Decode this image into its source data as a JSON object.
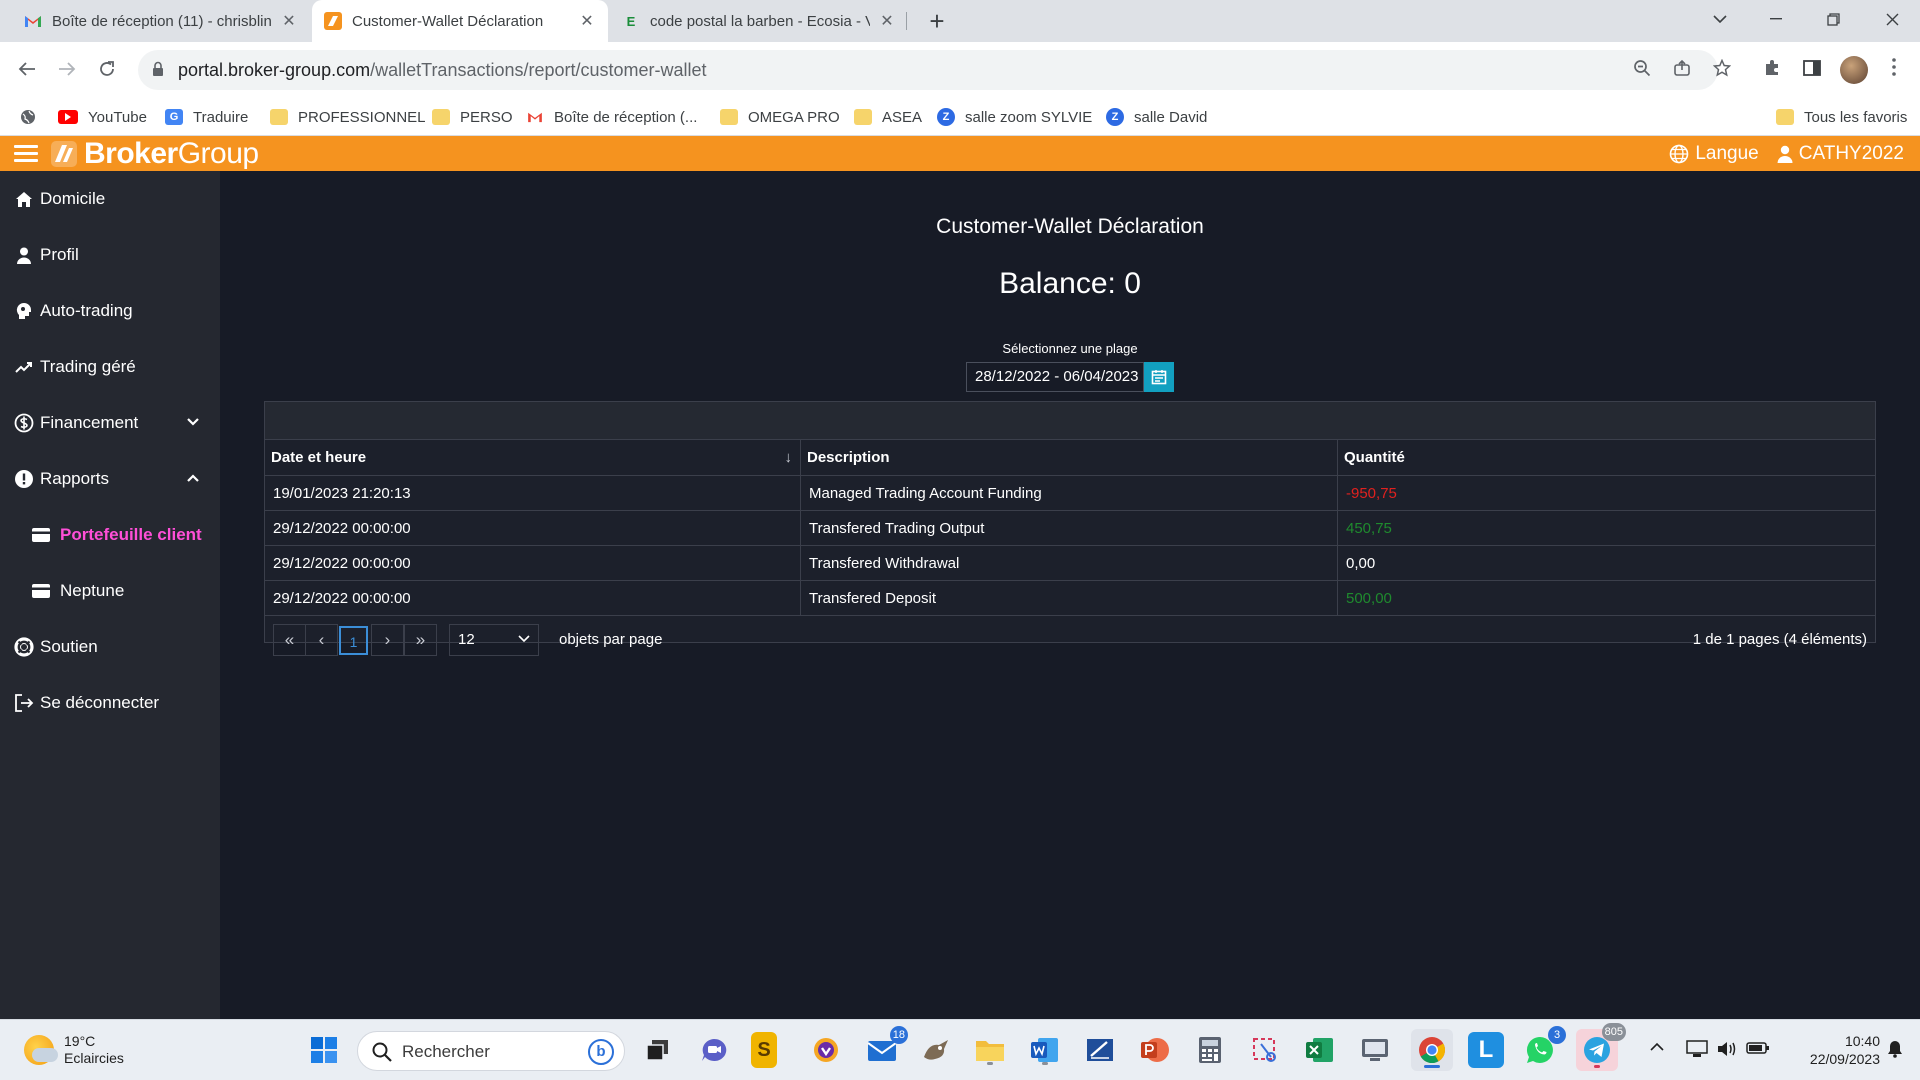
{
  "browser": {
    "tabs": [
      {
        "title": "Boîte de réception (11) - chrisblin",
        "icon": "gmail-icon"
      },
      {
        "title": "Customer-Wallet Déclaration",
        "icon": "brokergroup-icon"
      },
      {
        "title": "code postal la barben - Ecosia - V",
        "icon": "ecosia-icon"
      }
    ],
    "url_host": "portal.broker-group.com",
    "url_path": "/walletTransactions/report/customer-wallet",
    "bookmarks": [
      {
        "label": "YouTube"
      },
      {
        "label": "Traduire"
      },
      {
        "label": "PROFESSIONNEL"
      },
      {
        "label": "PERSO"
      },
      {
        "label": "Boîte de réception (..."
      },
      {
        "label": "OMEGA PRO"
      },
      {
        "label": "ASEA"
      },
      {
        "label": "salle zoom SYLVIE"
      },
      {
        "label": "salle David"
      },
      {
        "label": "Tous les favoris"
      }
    ]
  },
  "app": {
    "logo_bold": "Broker",
    "logo_light": "Group",
    "language_label": "Langue",
    "user_label": "CATHY2022",
    "brand_color": "#f5931f"
  },
  "sidebar": {
    "items": [
      {
        "label": "Domicile",
        "icon": "home-icon"
      },
      {
        "label": "Profil",
        "icon": "user-icon"
      },
      {
        "label": "Auto-trading",
        "icon": "robot-icon"
      },
      {
        "label": "Trading géré",
        "icon": "trend-icon"
      },
      {
        "label": "Financement",
        "icon": "dollar-icon",
        "expanded": false
      },
      {
        "label": "Rapports",
        "icon": "alert-icon",
        "expanded": true
      },
      {
        "label": "Portefeuille client",
        "icon": "wallet-icon",
        "active": true
      },
      {
        "label": "Neptune",
        "icon": "wallet-icon"
      },
      {
        "label": "Soutien",
        "icon": "lifebuoy-icon"
      },
      {
        "label": "Se déconnecter",
        "icon": "logout-icon"
      }
    ]
  },
  "report": {
    "title": "Customer-Wallet Déclaration",
    "balance": "Balance: 0",
    "range_label": "Sélectionnez une plage",
    "range_value": "28/12/2022 - 06/04/2023",
    "columns": [
      "Date et heure",
      "Description",
      "Quantité"
    ],
    "rows": [
      {
        "date": "19/01/2023 21:20:13",
        "description": "Managed Trading Account Funding",
        "amount": "-950,75",
        "tone": "negative"
      },
      {
        "date": "29/12/2022 00:00:00",
        "description": "Transfered Trading Output",
        "amount": "450,75",
        "tone": "positive"
      },
      {
        "date": "29/12/2022 00:00:00",
        "description": "Transfered Withdrawal",
        "amount": "0,00",
        "tone": "neutral"
      },
      {
        "date": "29/12/2022 00:00:00",
        "description": "Transfered Deposit",
        "amount": "500,00",
        "tone": "positive"
      }
    ],
    "colors": {
      "negative": "#e0211f",
      "positive": "#1f8a2e",
      "neutral": "#ffffff"
    },
    "pager": {
      "first": "«",
      "prev": "‹",
      "current": "1",
      "next": "›",
      "last": "»",
      "page_size": "12",
      "per_page_label": "objets par page",
      "info": "1 de 1 pages (4 éléments)"
    }
  },
  "taskbar": {
    "weather_temp": "19°C",
    "weather_desc": "Eclaircies",
    "search_placeholder": "Rechercher",
    "mail_badge": "18",
    "whatsapp_badge": "3",
    "telegram_badge": "805",
    "time": "10:40",
    "date": "22/09/2023"
  }
}
